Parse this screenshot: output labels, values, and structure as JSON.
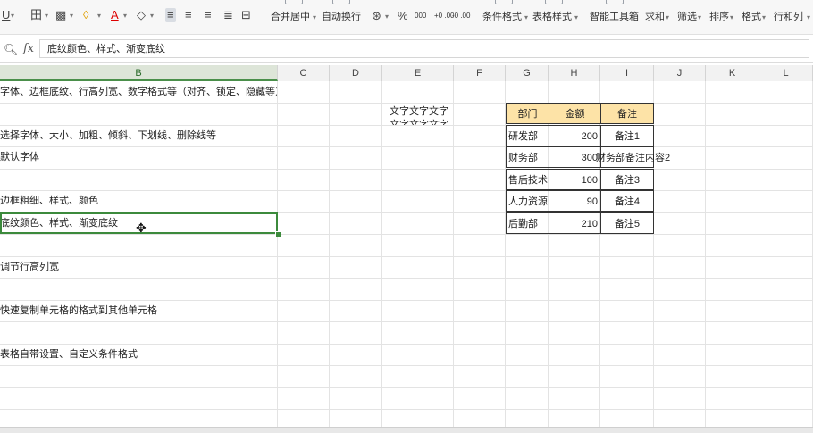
{
  "toolbar": {
    "items": [
      {
        "label": "U",
        "name": "underline-button"
      },
      {
        "label": "田",
        "name": "borders-button"
      },
      {
        "label": "▩",
        "name": "fill-pattern-button"
      },
      {
        "label": "◊",
        "name": "fill-color-button"
      },
      {
        "label": "A",
        "name": "font-color-button"
      },
      {
        "label": "◇",
        "name": "clear-format-button"
      }
    ],
    "merge_center": "合并居中",
    "wrap_text": "自动换行",
    "percent": "%",
    "thousands": "000",
    "dec_increase": "+0 .00",
    "dec_decrease": "-0 .00",
    "conditional_format": "条件格式",
    "table_style": "表格样式",
    "smart_toolbox": "智能工具箱",
    "sum": "求和",
    "filter": "筛选",
    "sort": "排序",
    "format": "格式",
    "row_col": "行和列"
  },
  "formula_bar": {
    "fx": "fx",
    "value": "底纹颜色、样式、渐变底纹"
  },
  "columns": [
    "B",
    "C",
    "D",
    "E",
    "F",
    "G",
    "H",
    "I",
    "J",
    "K",
    "L"
  ],
  "active_column": "B",
  "cells_b": [
    "字体、边框底纹、行高列宽、数字格式等（对齐、锁定、隐藏等）",
    "选择字体、大小、加粗、倾斜、下划线、删除线等",
    "默认字体",
    "边框粗细、样式、颜色",
    "底纹颜色、样式、渐变底纹",
    "调节行高列宽",
    "快速复制单元格的格式到其他单元格",
    "表格自带设置、自定义条件格式"
  ],
  "cell_e": "文字文字文字",
  "table": {
    "headers": [
      "部门",
      "金额",
      "备注"
    ],
    "rows": [
      [
        "研发部",
        "200",
        "备注1"
      ],
      [
        "财务部",
        "300",
        "财务部备注内容2"
      ],
      [
        "售后技术",
        "100",
        "备注3"
      ],
      [
        "人力资源",
        "90",
        "备注4"
      ],
      [
        "后勤部",
        "210",
        "备注5"
      ]
    ]
  },
  "colors": {
    "header_fill": "#fde3a7",
    "selection": "#3c8a3c"
  }
}
